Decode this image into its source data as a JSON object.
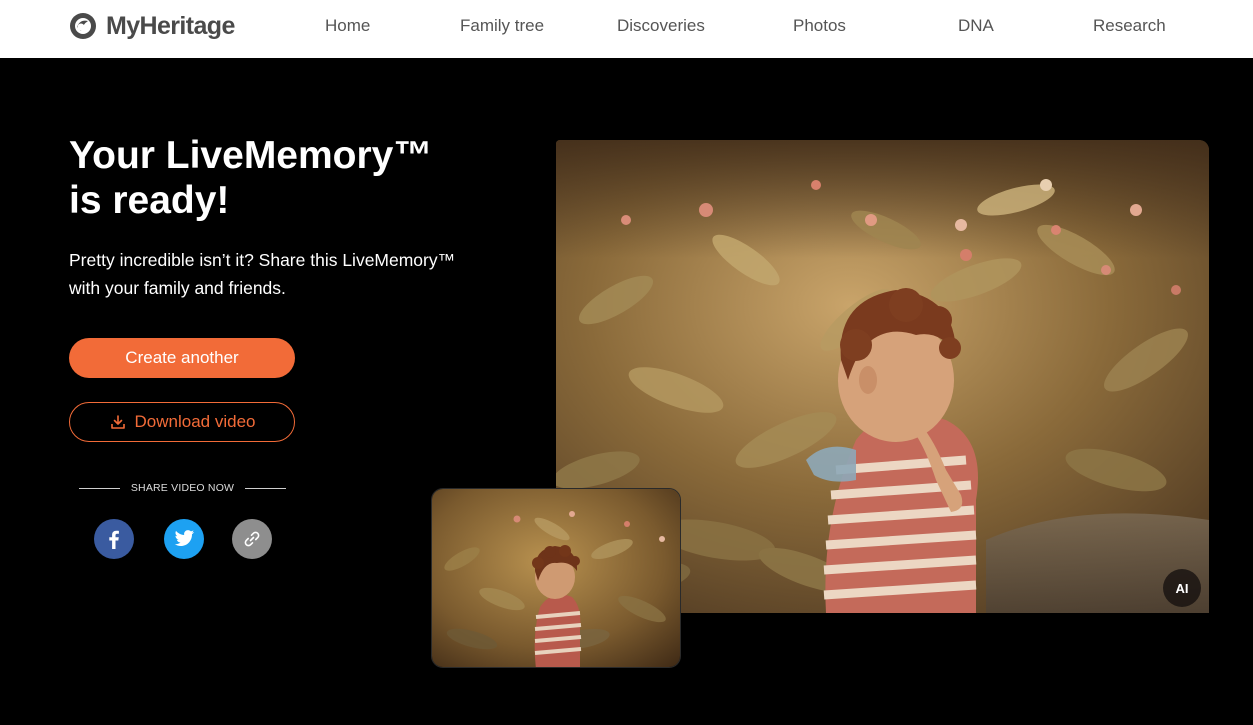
{
  "header": {
    "logo_text": "MyHeritage",
    "nav": [
      {
        "label": "Home"
      },
      {
        "label": "Family tree"
      },
      {
        "label": "Discoveries"
      },
      {
        "label": "Photos"
      },
      {
        "label": "DNA"
      },
      {
        "label": "Research"
      }
    ]
  },
  "hero": {
    "title_line1": "Your LiveMemory™",
    "title_line2": "is ready!",
    "subtitle": "Pretty incredible isn’t it? Share this LiveMemory™ with your family and friends.",
    "create_button": "Create another",
    "download_button": "Download video",
    "share_label": "SHARE VIDEO NOW",
    "social": [
      {
        "icon": "facebook-icon",
        "color": "#3a5ba0"
      },
      {
        "icon": "twitter-icon",
        "color": "#1da1f2"
      },
      {
        "icon": "link-icon",
        "color": "#8e8e8e"
      }
    ]
  },
  "media": {
    "ai_badge": "AI"
  },
  "colors": {
    "accent": "#f26b38",
    "background": "#000000",
    "header_bg": "#ffffff"
  }
}
